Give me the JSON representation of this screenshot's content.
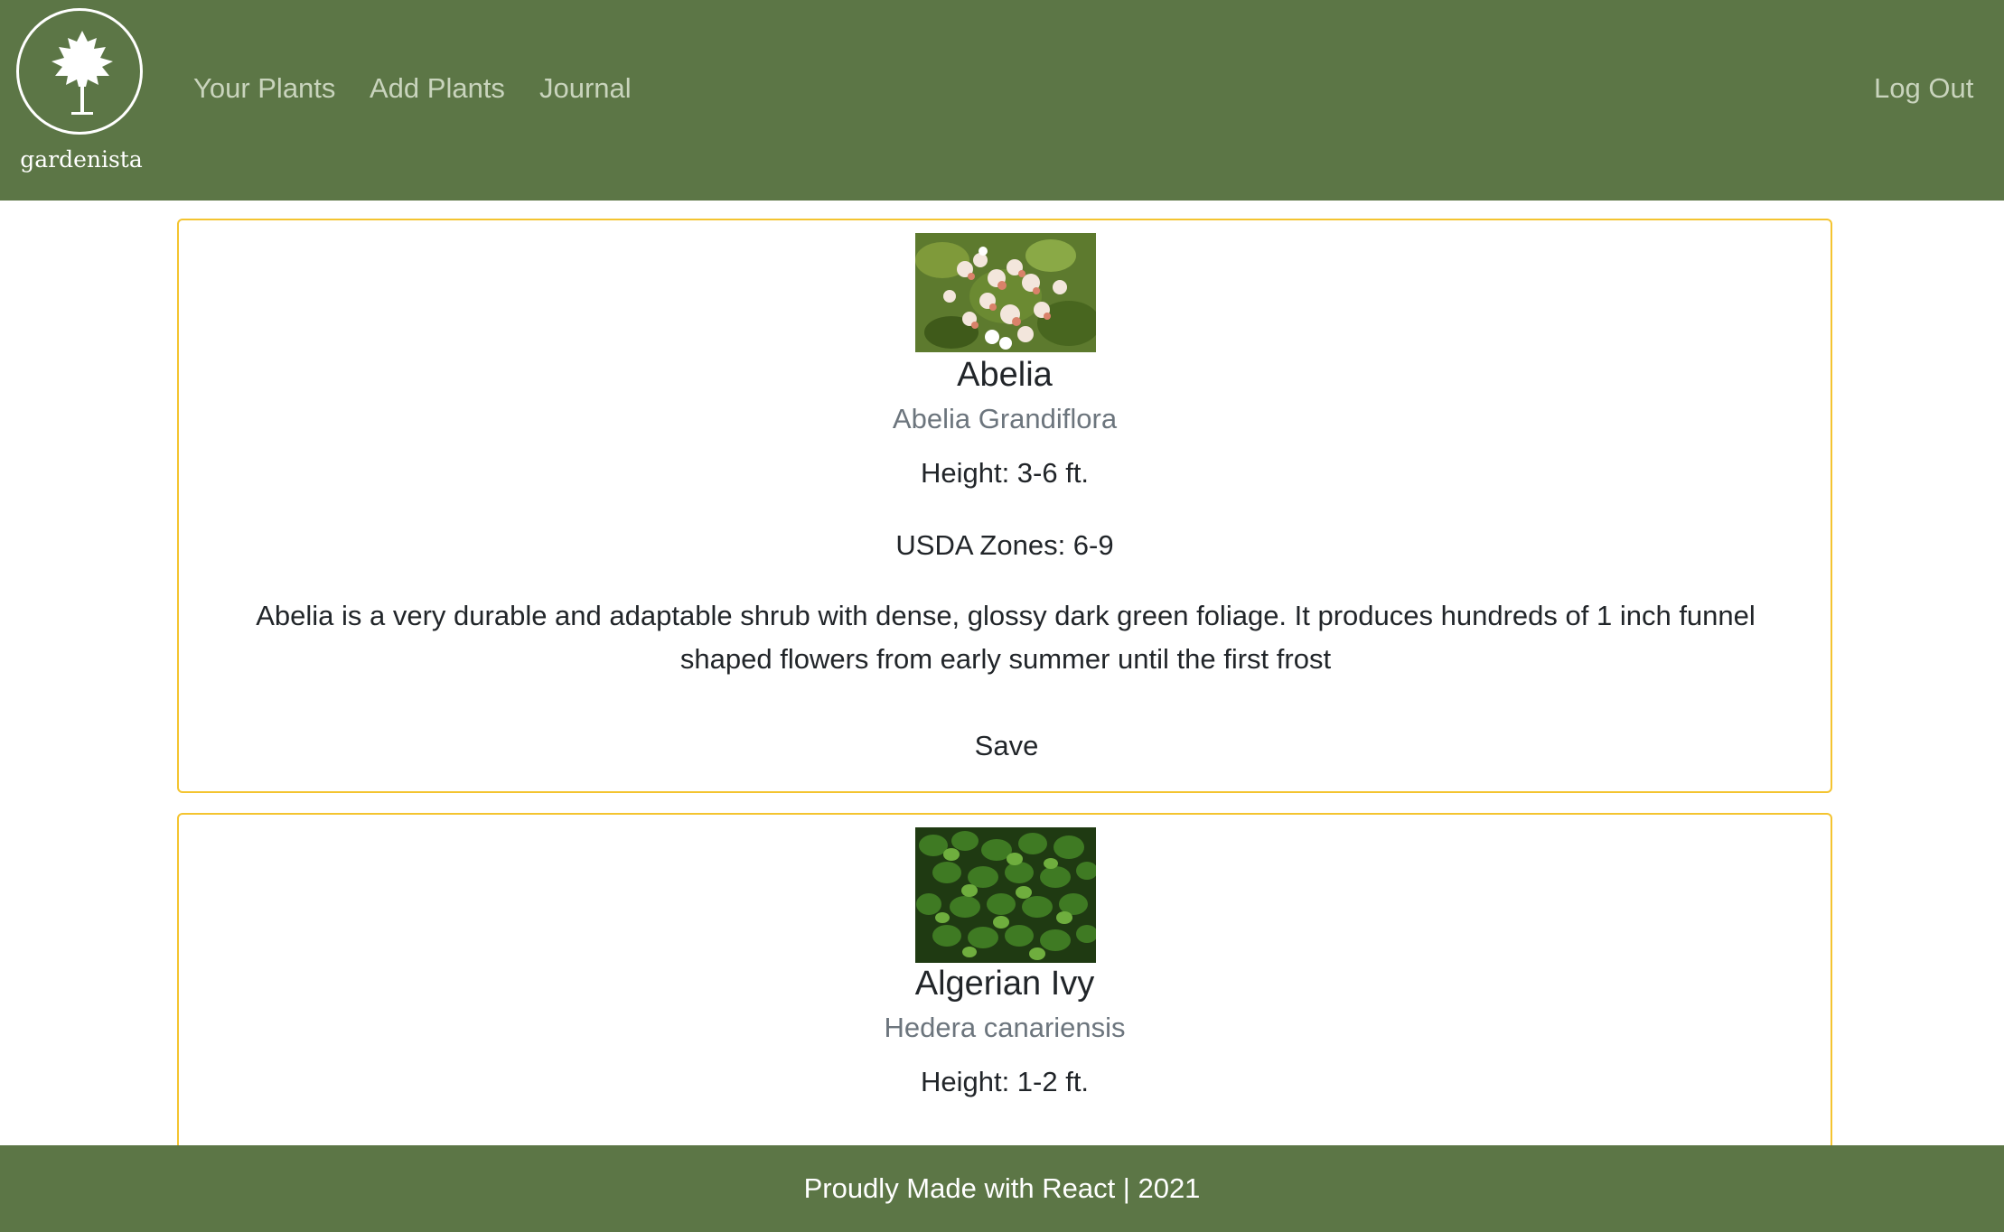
{
  "brand": {
    "name": "gardenista"
  },
  "nav": {
    "links": [
      {
        "label": "Your Plants"
      },
      {
        "label": "Add Plants"
      },
      {
        "label": "Journal"
      }
    ],
    "logout_label": "Log Out"
  },
  "plants": [
    {
      "name": "Abelia",
      "scientific_name": "Abelia Grandiflora",
      "height": "Height: 3-6 ft.",
      "zones": "USDA Zones: 6-9",
      "description": "Abelia is a very durable and adaptable shrub with dense, glossy dark green foliage. It produces hundreds of 1 inch funnel shaped flowers from early summer until the first frost",
      "save_label": "Save"
    },
    {
      "name": "Algerian Ivy",
      "scientific_name": "Hedera canariensis",
      "height": "Height: 1-2 ft."
    }
  ],
  "footer": {
    "text": "Proudly Made with React | 2021"
  },
  "colors": {
    "navbar": "#5c7646",
    "card_border": "#f4c430",
    "nav_link": "#c9d4bd",
    "muted_text": "#6c757d"
  }
}
